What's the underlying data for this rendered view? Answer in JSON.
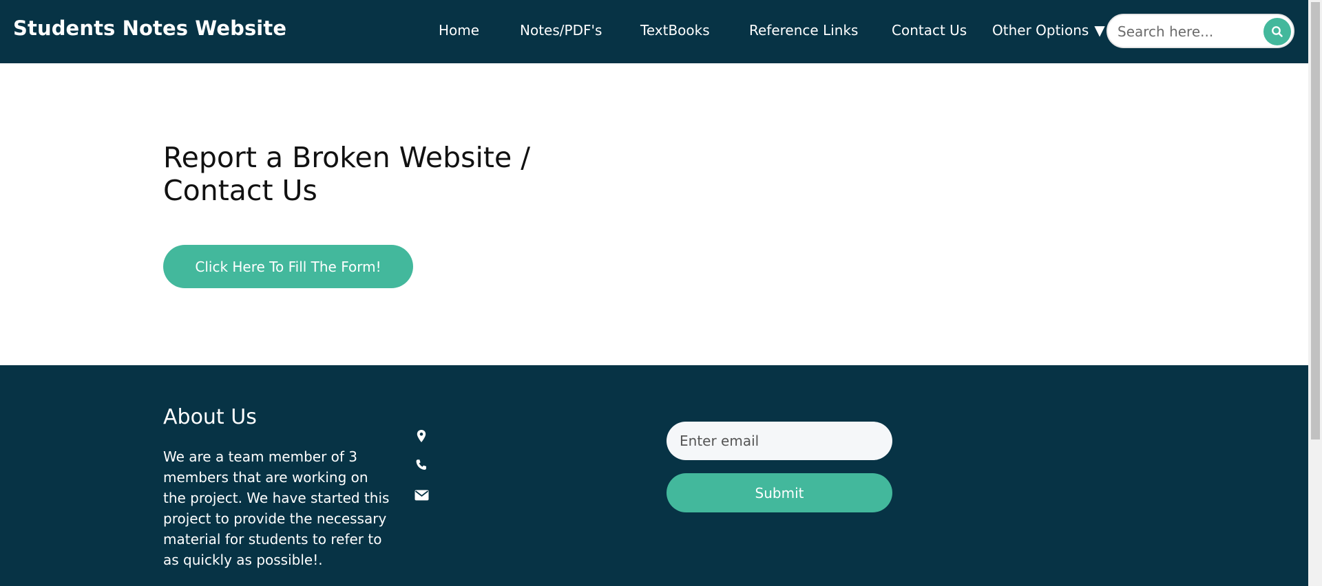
{
  "navbar": {
    "brand": "Students Notes Website",
    "links": [
      "Home",
      "Notes/PDF's",
      "TextBooks",
      "Reference Links",
      "Contact Us"
    ],
    "other_options": "Other Options",
    "search_placeholder": "Search here...",
    "search_icon": "search-icon"
  },
  "main": {
    "title": "Report a Broken Website / Contact Us",
    "form_button": "Click Here To Fill The Form!"
  },
  "footer": {
    "about_title": "About Us",
    "about_text": "We are a team member of 3 members that are working on the project. We have started this project to provide the necessary material for students to refer to as quickly as possible!.",
    "contact_icons": [
      "location-pin-icon",
      "phone-icon",
      "envelope-icon"
    ],
    "email_placeholder": "Enter email",
    "submit_label": "Submit"
  },
  "colors": {
    "navy": "#073345",
    "accent": "#43b89c",
    "white": "#ffffff"
  }
}
